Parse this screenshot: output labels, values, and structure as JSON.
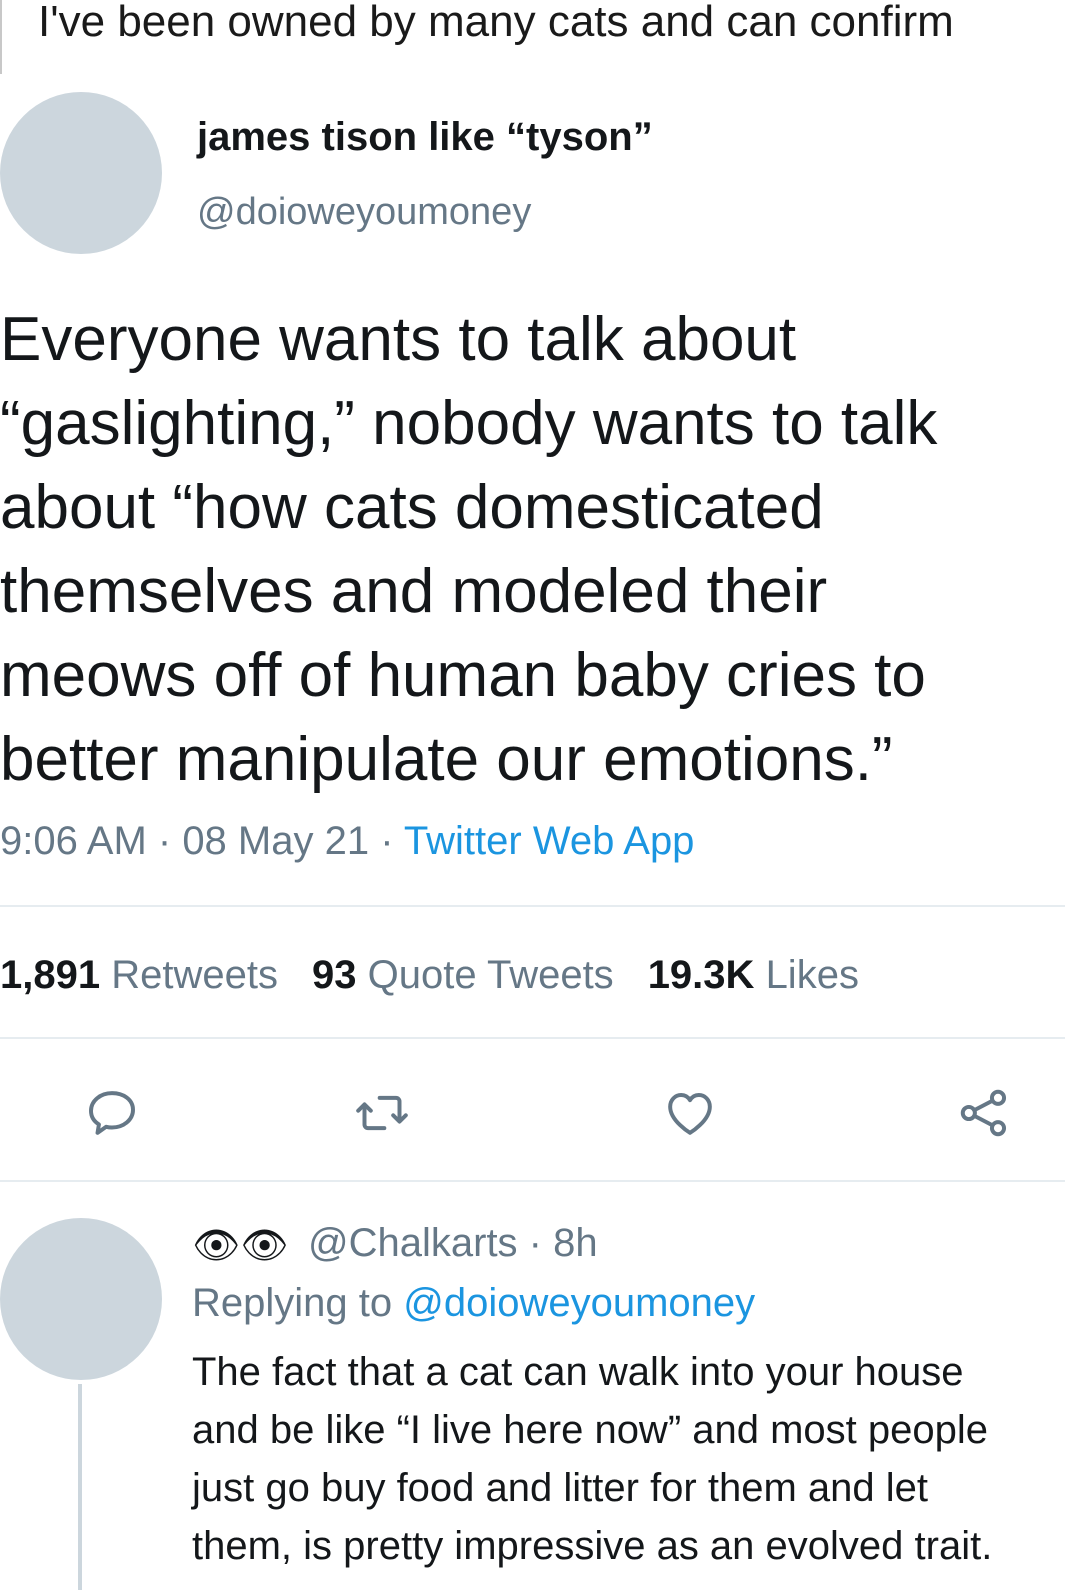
{
  "caption": "I've been owned by many cats and can confirm",
  "tweet": {
    "display_name": "james tison like “tyson”",
    "handle": "@doioweyoumoney",
    "text_lines": [
      "Everyone wants to talk about",
      "“gaslighting,” nobody wants to talk",
      "about “how cats domesticated",
      "themselves and modeled their",
      "meows off of human baby cries to",
      "better manipulate our emotions.”"
    ],
    "time": "9:06 AM",
    "date": "08 May 21",
    "separator": " · ",
    "source_app": "Twitter Web App",
    "stats": {
      "retweets_count": "1,891",
      "retweets_label": "Retweets",
      "quote_tweets_count": "93",
      "quote_tweets_label": "Quote Tweets",
      "likes_count": "19.3K",
      "likes_label": "Likes"
    },
    "actions": {
      "reply_icon": "reply-icon",
      "retweet_icon": "retweet-icon",
      "like_icon": "heart-icon",
      "share_icon": "share-icon"
    }
  },
  "reply": {
    "emoji": "👁👁",
    "handle": "@Chalkarts",
    "time_ago": "8h",
    "separator": " · ",
    "replying_label": "Replying to",
    "replying_to": "@doioweyoumoney",
    "text_lines": [
      "The fact that a cat can walk into your house",
      "and be like “I live here now” and most people",
      "just go buy food and litter for them and let",
      "them, is pretty impressive as an evolved trait."
    ]
  },
  "colors": {
    "text": "#14171a",
    "secondary": "#657786",
    "link": "#1b95e0",
    "avatar": "#ccd6dd",
    "divider": "#e6ecf0"
  }
}
